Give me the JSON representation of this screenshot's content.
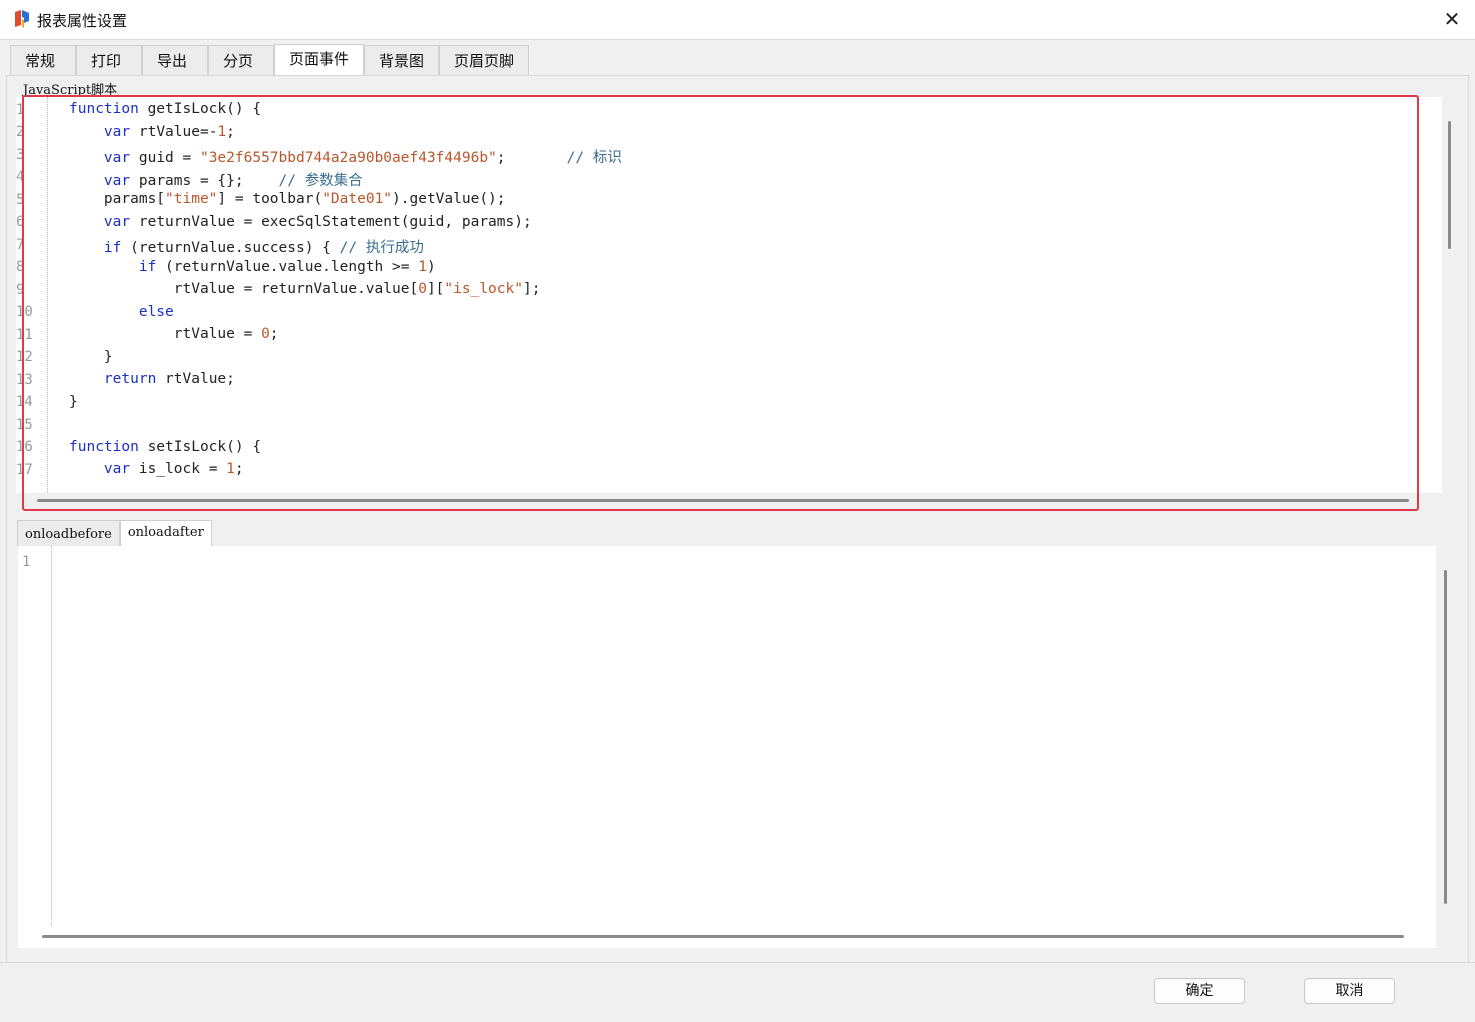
{
  "window": {
    "title": "报表属性设置",
    "close_glyph": "✕"
  },
  "tabs": [
    {
      "label": "常规",
      "active": false
    },
    {
      "label": "打印",
      "active": false
    },
    {
      "label": "导出",
      "active": false
    },
    {
      "label": "分页",
      "active": false
    },
    {
      "label": "页面事件",
      "active": true
    },
    {
      "label": "背景图",
      "active": false
    },
    {
      "label": "页眉页脚",
      "active": false
    }
  ],
  "script_section": {
    "label": "JavaScript脚本",
    "line_numbers": [
      "1",
      "2",
      "3",
      "4",
      "5",
      "6",
      "7",
      "8",
      "9",
      "10",
      "11",
      "12",
      "13",
      "14",
      "15",
      "16",
      "17"
    ],
    "code_lines": [
      "function getIsLock() {",
      "    var rtValue=-1;",
      "    var guid = \"3e2f6557bbd744a2a90b0aef43f4496b\";       // 标识",
      "    var params = {};    // 参数集合",
      "    params[\"time\"] = toolbar(\"Date01\").getValue();",
      "    var returnValue = execSqlStatement(guid, params);",
      "    if (returnValue.success) { // 执行成功",
      "        if (returnValue.value.length >= 1)",
      "            rtValue = returnValue.value[0][\"is_lock\"];",
      "        else",
      "            rtValue = 0;",
      "    }",
      "    return rtValue;",
      "}",
      "",
      "function setIsLock() {",
      "    var is_lock = 1;"
    ]
  },
  "event_tabs": [
    {
      "label": "onloadbefore",
      "active": false
    },
    {
      "label": "onloadafter",
      "active": true
    }
  ],
  "event_editor": {
    "line_numbers": [
      "1"
    ]
  },
  "buttons": {
    "ok": "确定",
    "cancel": "取消"
  },
  "colors": {
    "keyword": "#1a2fc4",
    "string": "#b9572c",
    "comment": "#3a6e8c",
    "highlight_border": "#e03a4a"
  }
}
